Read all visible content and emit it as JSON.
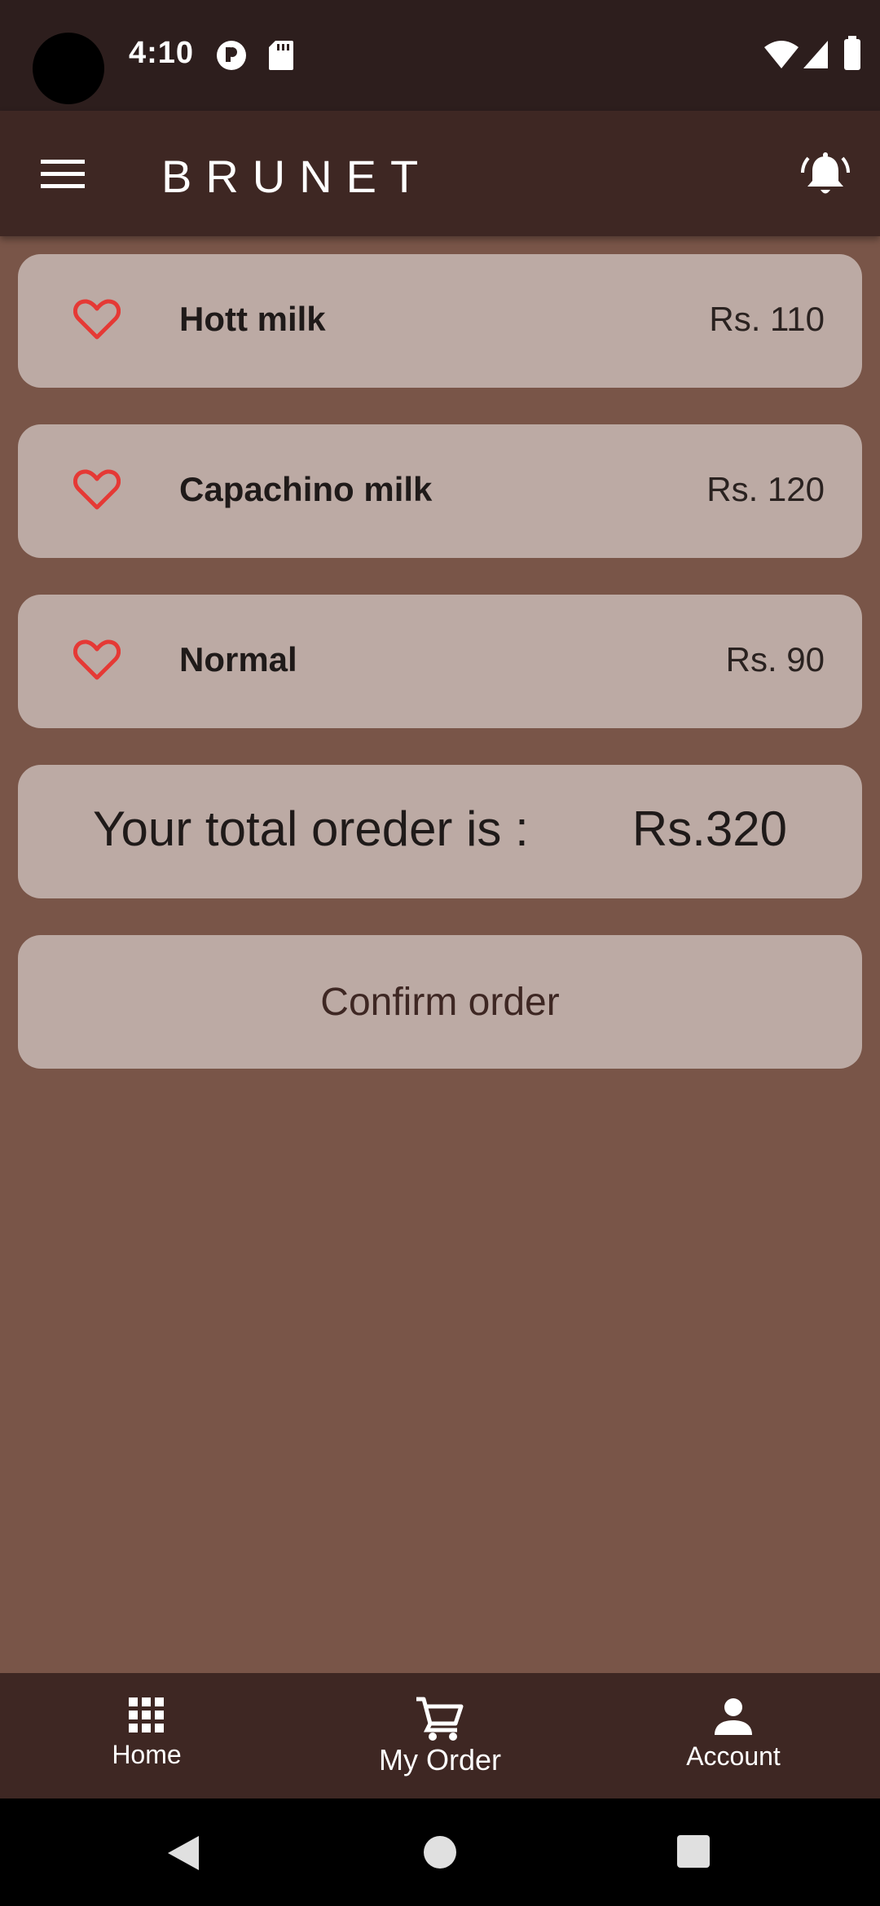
{
  "status_bar": {
    "time": "4:10",
    "icons": [
      "privacy-indicator-icon",
      "sd-card-icon",
      "wifi-icon",
      "signal-icon",
      "battery-icon"
    ]
  },
  "app_bar": {
    "title": "BRUNET",
    "menu_icon": "menu-icon",
    "bell_icon": "notification-bell-icon"
  },
  "order_items": [
    {
      "name": "Hott milk",
      "price": "Rs. 110",
      "icon": "heart-icon"
    },
    {
      "name": "Capachino milk",
      "price": "Rs. 120",
      "icon": "heart-icon"
    },
    {
      "name": "Normal",
      "price": "Rs. 90",
      "icon": "heart-icon"
    }
  ],
  "total": {
    "label": "Your total oreder is :",
    "value": "Rs.320"
  },
  "confirm_button": {
    "label": "Confirm order"
  },
  "bottom_nav": {
    "items": [
      {
        "label": "Home",
        "icon": "grid-icon"
      },
      {
        "label": "My Order",
        "icon": "cart-icon"
      },
      {
        "label": "Account",
        "icon": "person-icon"
      }
    ],
    "active": "My Order"
  },
  "colors": {
    "status_bar": "#2d1e1d",
    "app_bar": "#3e2723",
    "background": "#795548",
    "card": "#bcaaa4",
    "heart": "#e53935"
  }
}
